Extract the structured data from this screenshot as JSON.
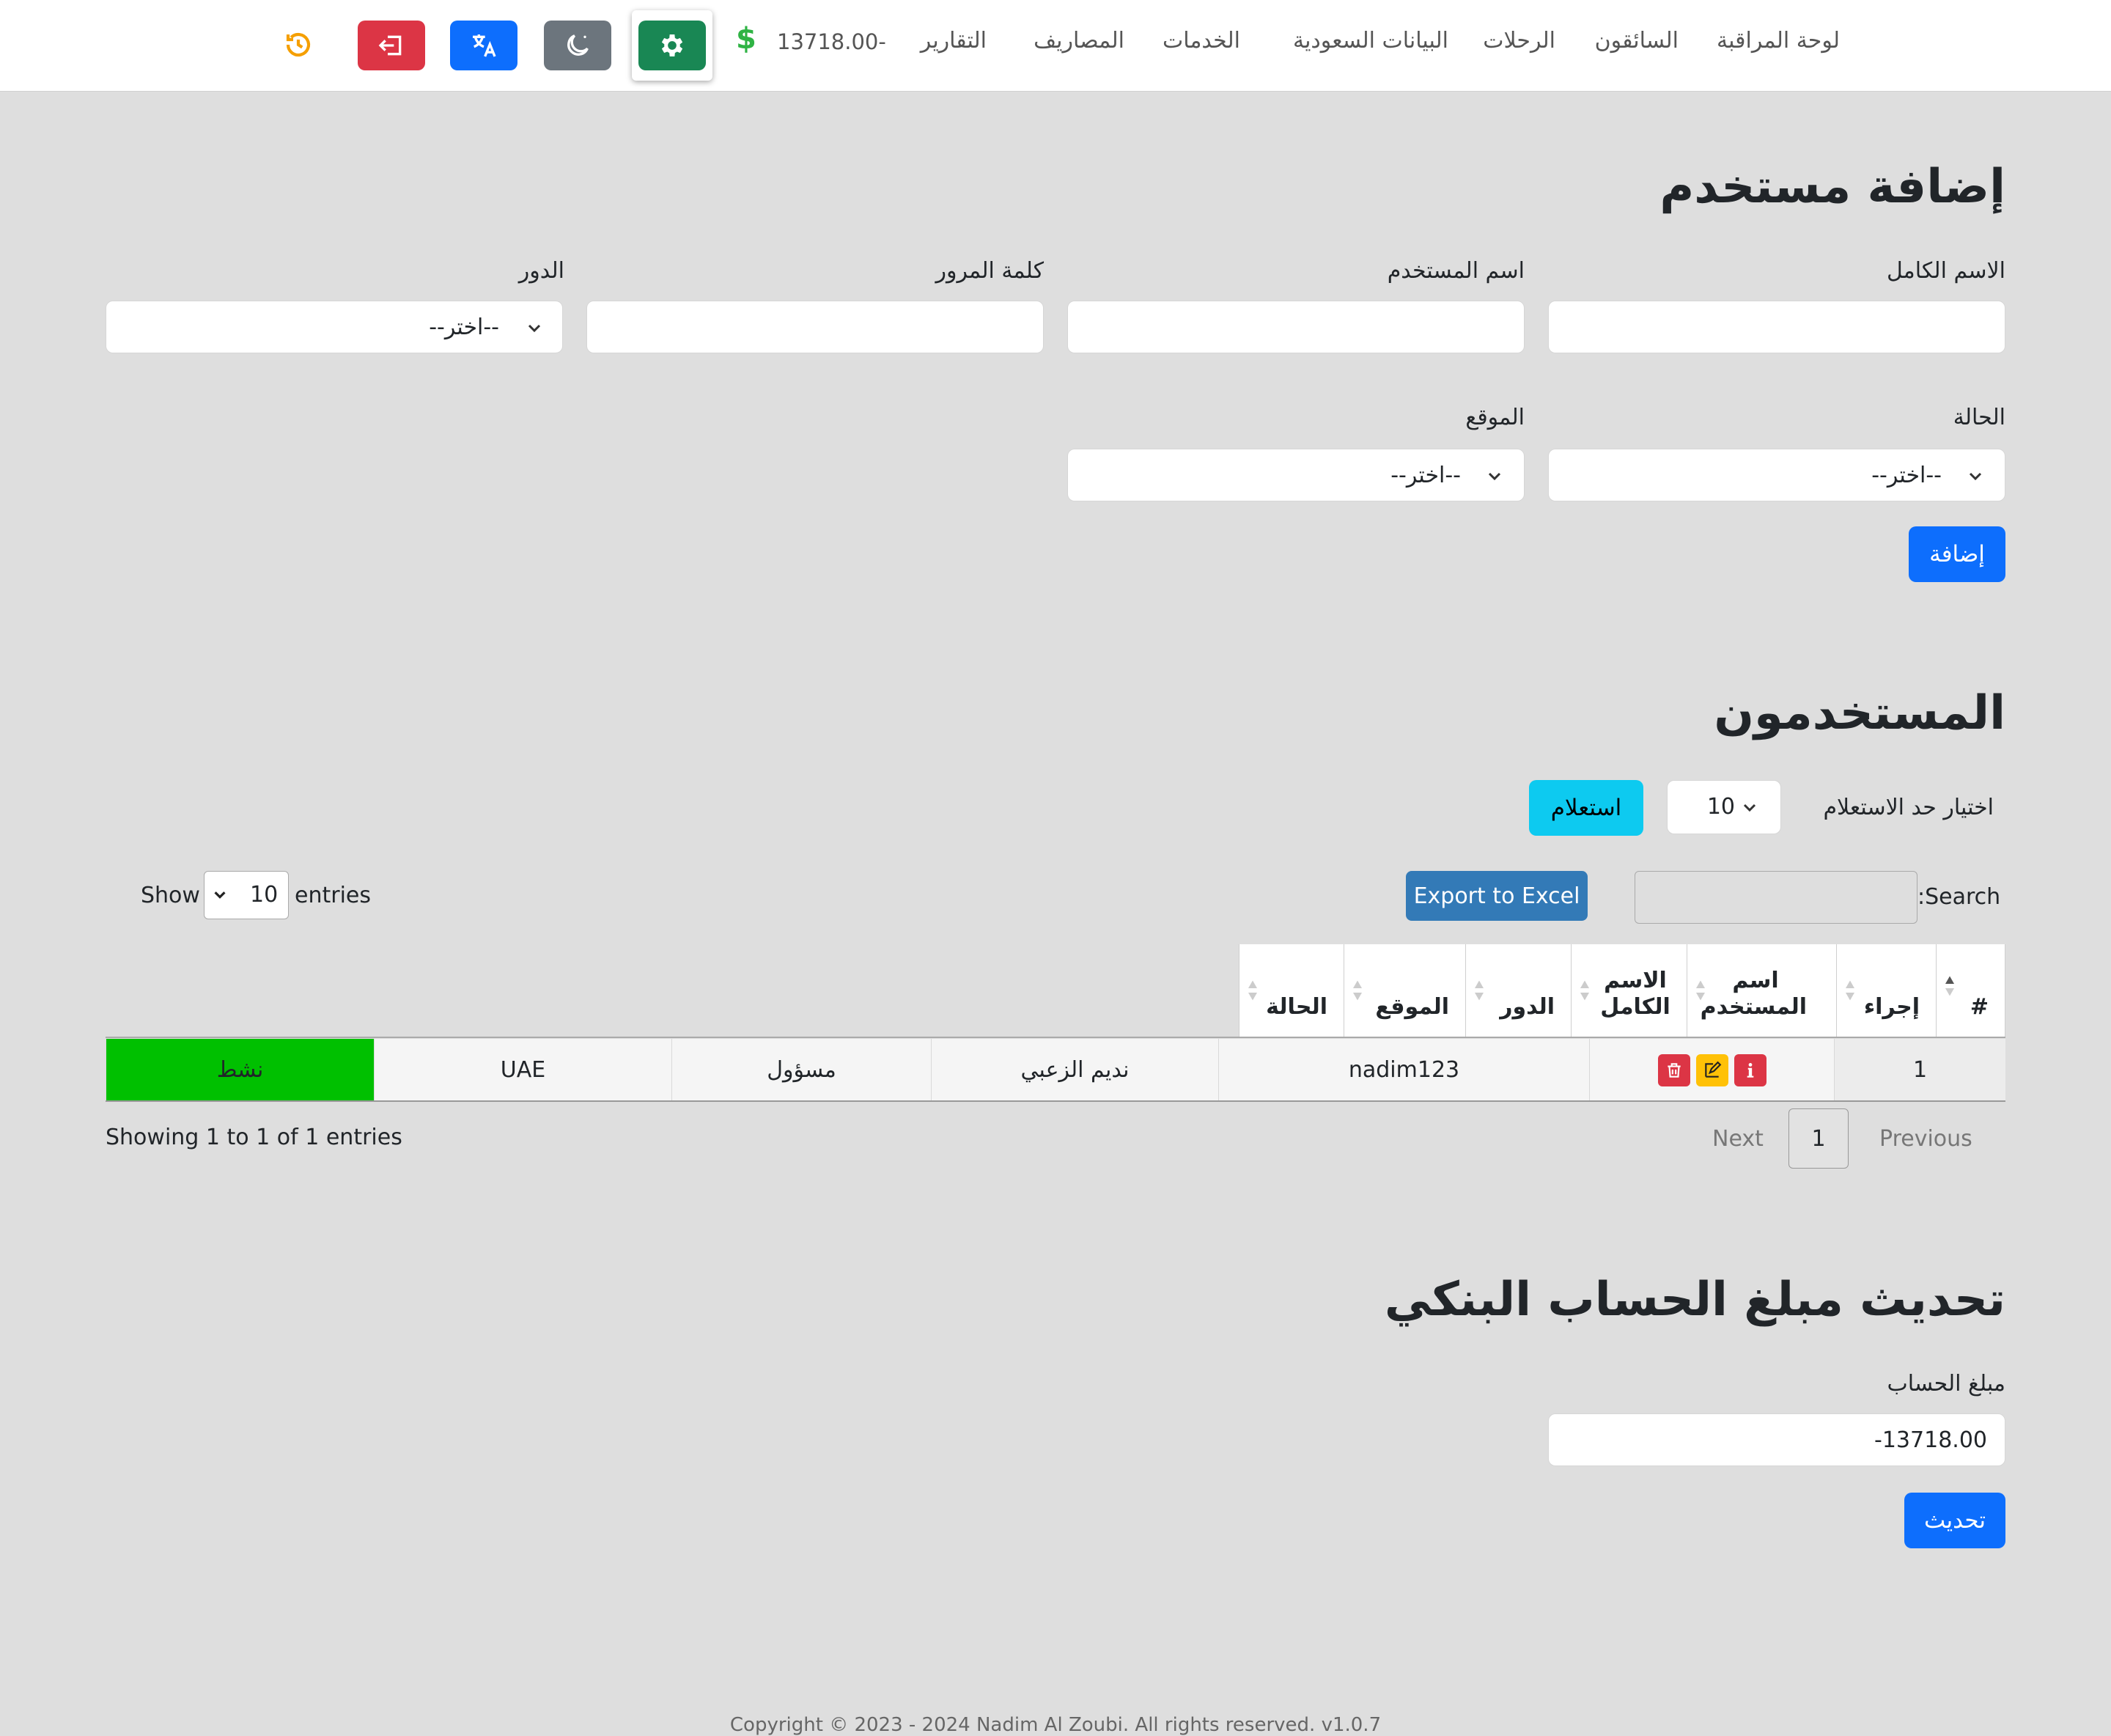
{
  "nav": {
    "items": [
      "لوحة المراقبة",
      "السائقون",
      "الرحلات",
      "البيانات السعودية",
      "الخدمات",
      "المصاريف",
      "التقارير"
    ],
    "balance": "13718.00-",
    "dollar_glyph": "$"
  },
  "add_user": {
    "title": "إضافة مستخدم",
    "full_name_label": "الاسم الكامل",
    "username_label": "اسم المستخدم",
    "password_label": "كلمة المرور",
    "role_label": "الدور",
    "role_value": "--اختر--",
    "status_label": "الحالة",
    "status_value": "--اختر--",
    "location_label": "الموقع",
    "location_value": "--اختر--",
    "add_button": "إضافة"
  },
  "users": {
    "title": "المستخدمون",
    "limit_label": "اختيار حد الاستعلام",
    "limit_value": "10",
    "query_button": "استعلام",
    "search_label": ":Search",
    "export_button": "Export to Excel",
    "show_label": "Show",
    "entries_value": "10",
    "entries_label": "entries",
    "columns": {
      "num": "#",
      "action": "إجراء",
      "username": "اسم المستخدم",
      "full_name": "الاسم الكامل",
      "role": "الدور",
      "location": "الموقع",
      "status": "الحالة"
    },
    "rows": [
      {
        "num": "1",
        "username": "nadim123",
        "full_name": "نديم الزعبي",
        "role": "مسؤول",
        "location": "UAE",
        "status": "نشط"
      }
    ],
    "info": "Showing 1 to 1 of 1 entries",
    "next": "Next",
    "page": "1",
    "previous": "Previous"
  },
  "bank": {
    "title": "تحديث مبلغ الحساب البنكي",
    "amount_label": "مبلغ الحساب",
    "amount_value": "13718.00-",
    "update_button": "تحديث"
  },
  "footer": {
    "text": "Copyright © 2023 - 2024 Nadim Al Zoubi. All rights reserved. v1.0.7"
  },
  "colors": {
    "primary": "#0d6efd",
    "info": "#0dcaf0",
    "danger": "#dc3545",
    "secondary": "#6c757d",
    "success_dark": "#198754",
    "warning": "#ffc107",
    "status_active": "#00c000",
    "excel": "#337ab7",
    "history": "#f59f00"
  },
  "icons": [
    "history-icon",
    "logout-icon",
    "translate-icon",
    "moon-icon",
    "gear-icon",
    "dollar-icon",
    "trash-icon",
    "edit-icon",
    "info-icon",
    "chevron-down-icon",
    "sort-icon"
  ]
}
